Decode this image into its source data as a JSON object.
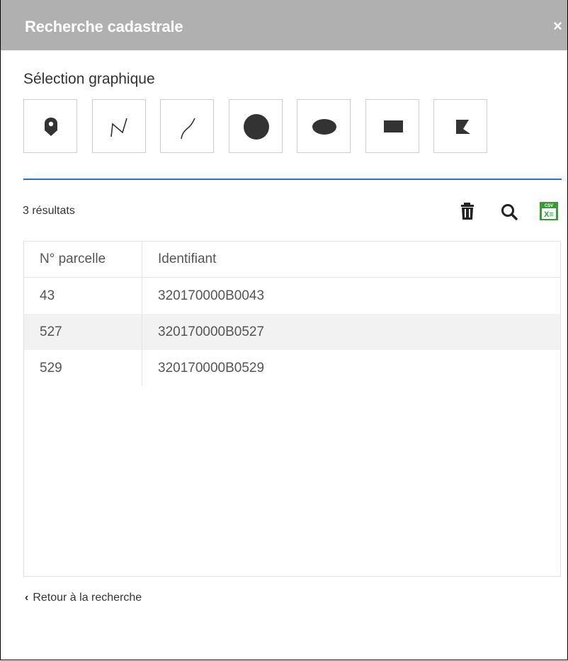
{
  "window": {
    "title": "Recherche cadastrale",
    "close_glyph": "×"
  },
  "graphic_selection": {
    "label": "Sélection graphique",
    "tools": [
      {
        "icon": "point-marker-icon"
      },
      {
        "icon": "polyline-icon"
      },
      {
        "icon": "freehand-line-icon"
      },
      {
        "icon": "circle-icon"
      },
      {
        "icon": "ellipse-icon"
      },
      {
        "icon": "rectangle-icon"
      },
      {
        "icon": "polygon-icon"
      }
    ]
  },
  "results": {
    "count_label": "3 résultats",
    "actions": [
      "trash-icon",
      "search-icon",
      "csv-export-icon"
    ],
    "csv_badge": "CSV",
    "csv_sub": "X≡",
    "columns": [
      "N° parcelle",
      "Identifiant"
    ],
    "rows": [
      [
        "43",
        "320170000B0043"
      ],
      [
        "527",
        "320170000B0527"
      ],
      [
        "529",
        "320170000B0529"
      ]
    ]
  },
  "footer": {
    "back_label": "Retour à la recherche",
    "back_glyph": "‹"
  },
  "colors": {
    "titlebar": "#b0b0b0",
    "accent_rule": "#2a73b7",
    "icon": "#333333",
    "csv_green": "#3a9a3a",
    "row_alt": "#f2f2f2"
  }
}
